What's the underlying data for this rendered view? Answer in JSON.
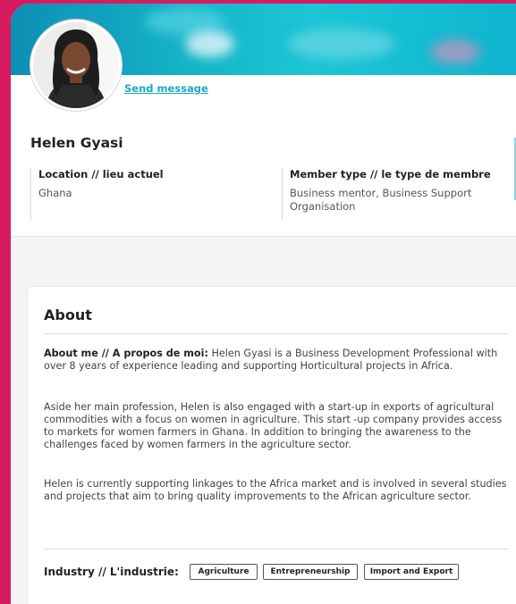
{
  "profile": {
    "send_message": "Send message",
    "name": "Helen Gyasi",
    "location_label": "Location // lieu actuel",
    "location_value": "Ghana",
    "member_type_label": "Member type // le type de membre",
    "member_type_value": "Business mentor, Business Support Organisation"
  },
  "about": {
    "title": "About",
    "about_me_label": "About me // A propos de moi:",
    "about_me_text": "Helen Gyasi is a Business Development Professional with over 8 years of experience leading and supporting Horticultural projects in Africa.",
    "paragraph_2": "Aside her main profession, Helen is also engaged with a start-up in exports of agricultural commodities with a focus on women in agriculture. This start -up company provides access to markets for women farmers in Ghana. In addition to bringing the awareness to the challenges faced by women farmers in the agriculture sector.",
    "paragraph_3": "Helen is currently supporting linkages to the Africa market and is involved in several studies and projects that aim to bring quality improvements to the African agriculture sector.",
    "industry_label": "Industry // L'industrie:",
    "industries": [
      "Agriculture",
      "Entrepreneurship",
      "Import and Export"
    ]
  },
  "colors": {
    "page_border": "#d81b60",
    "accent": "#17a9c6",
    "banner": "#15b3c8"
  }
}
